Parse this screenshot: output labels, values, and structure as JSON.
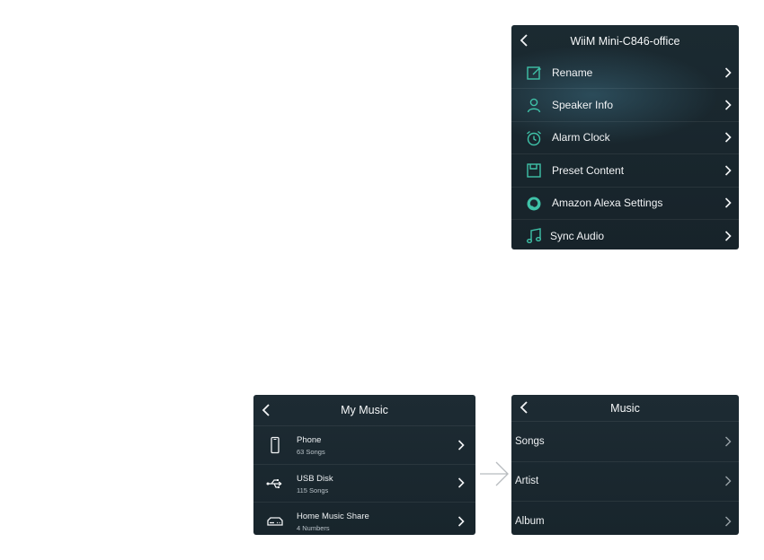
{
  "settings": {
    "title": "WiiM Mini-C846-office",
    "items": [
      {
        "label": "Rename",
        "icon": "edit-icon"
      },
      {
        "label": "Speaker Info",
        "icon": "person-icon"
      },
      {
        "label": "Alarm Clock",
        "icon": "alarm-clock-icon"
      },
      {
        "label": "Preset Content",
        "icon": "save-icon"
      },
      {
        "label": "Amazon Alexa Settings",
        "icon": "alexa-icon"
      },
      {
        "label": "Sync Audio",
        "icon": "music-note-icon"
      }
    ]
  },
  "my_music": {
    "title": "My Music",
    "items": [
      {
        "label": "Phone",
        "sub": "63  Songs",
        "icon": "phone-icon"
      },
      {
        "label": "USB Disk",
        "sub": "115  Songs",
        "icon": "usb-icon"
      },
      {
        "label": "Home Music Share",
        "sub": "4 Numbers",
        "icon": "media-server-icon"
      }
    ]
  },
  "music": {
    "title": "Music",
    "items": [
      {
        "label": "Songs"
      },
      {
        "label": "Artist"
      },
      {
        "label": "Album"
      }
    ]
  },
  "colors": {
    "accent": "#3fc2a8",
    "panel_bg": "#1b2930",
    "text": "#f2f4f6"
  }
}
